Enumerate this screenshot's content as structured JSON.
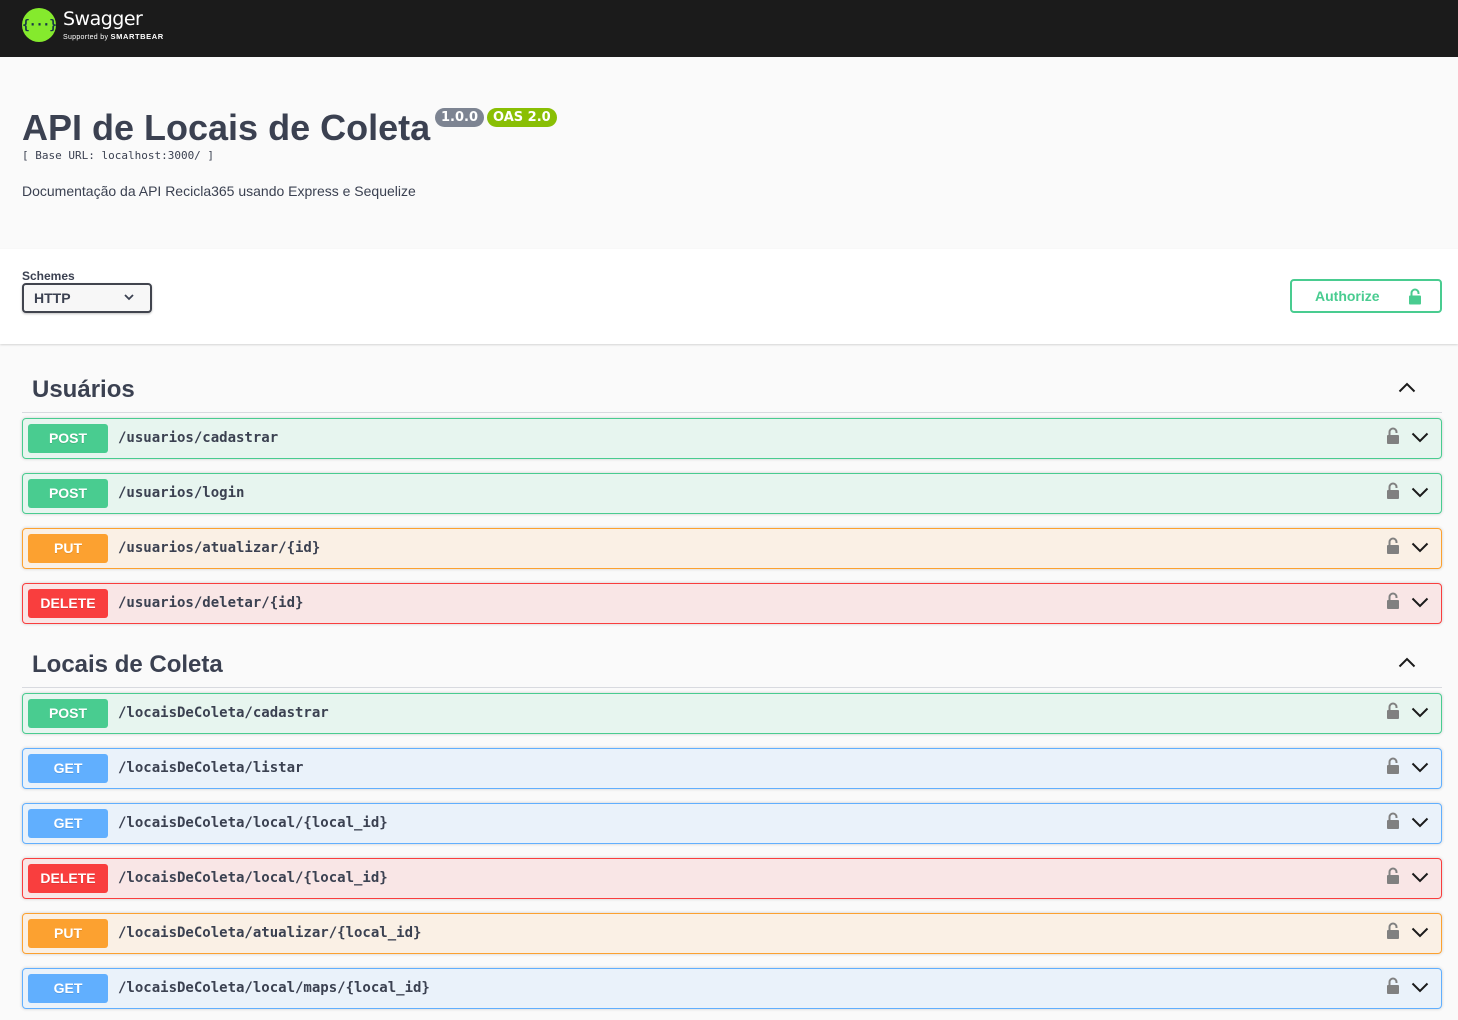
{
  "header": {
    "logo_symbol": "{···}",
    "logo_name": "Swagger",
    "logo_sub_prefix": "Supported by",
    "logo_sub_brand": "SMARTBEAR"
  },
  "info": {
    "title": "API de Locais de Coleta",
    "version_badge": "1.0.0",
    "oas_badge": "OAS 2.0",
    "base_url": "[ Base URL: localhost:3000/ ]",
    "description": "Documentação da API Recicla365 usando Express e Sequelize"
  },
  "schemes": {
    "label": "Schemes",
    "selected": "HTTP"
  },
  "authorize": {
    "label": "Authorize"
  },
  "colors": {
    "post": "#49cc90",
    "put": "#fca130",
    "delete": "#f93e3e",
    "get": "#61affe",
    "topbar": "#1b1b1b",
    "logo": "#85ea2d"
  },
  "icons": {
    "lock": "lock-icon",
    "expand": "chevron-down-icon",
    "collapse": "chevron-up-icon"
  },
  "tags": [
    {
      "name": "Usuários",
      "operations": [
        {
          "method": "POST",
          "path": "/usuarios/cadastrar"
        },
        {
          "method": "POST",
          "path": "/usuarios/login"
        },
        {
          "method": "PUT",
          "path": "/usuarios/atualizar/{id}"
        },
        {
          "method": "DELETE",
          "path": "/usuarios/deletar/{id}"
        }
      ]
    },
    {
      "name": "Locais de Coleta",
      "operations": [
        {
          "method": "POST",
          "path": "/locaisDeColeta/cadastrar"
        },
        {
          "method": "GET",
          "path": "/locaisDeColeta/listar"
        },
        {
          "method": "GET",
          "path": "/locaisDeColeta/local/{local_id}"
        },
        {
          "method": "DELETE",
          "path": "/locaisDeColeta/local/{local_id}"
        },
        {
          "method": "PUT",
          "path": "/locaisDeColeta/atualizar/{local_id}"
        },
        {
          "method": "GET",
          "path": "/locaisDeColeta/local/maps/{local_id}"
        }
      ]
    }
  ]
}
